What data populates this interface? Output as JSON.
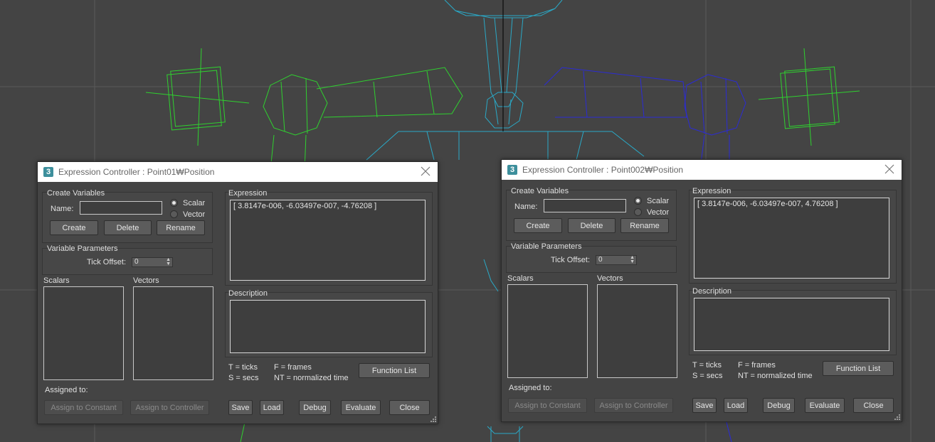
{
  "viewport": {
    "wire_colors": {
      "cyan": "#2aa9c7",
      "green": "#2fd12f",
      "blue": "#2b2bd6",
      "grid": "#5a5a5a"
    }
  },
  "dialogs": [
    {
      "title": "Expression Controller : Point01₩Position",
      "create_variables": "Create Variables",
      "name_label": "Name:",
      "name_value": "",
      "scalar_label": "Scalar",
      "vector_label": "Vector",
      "create": "Create",
      "delete": "Delete",
      "rename": "Rename",
      "variable_parameters": "Variable Parameters",
      "tick_offset_label": "Tick Offset:",
      "tick_offset_value": "0",
      "scalars": "Scalars",
      "vectors": "Vectors",
      "expression_label": "Expression",
      "expression_text": "[ 3.8147e-006, -6.03497e-007, -4.76208 ]",
      "description_label": "Description",
      "description_text": "",
      "legend_t": "T = ticks",
      "legend_s": "S = secs",
      "legend_f": "F = frames",
      "legend_nt": "NT = normalized time",
      "function_list": "Function List",
      "assigned_to": "Assigned to:",
      "assign_constant": "Assign to Constant",
      "assign_controller": "Assign to Controller",
      "save": "Save",
      "load": "Load",
      "debug": "Debug",
      "evaluate": "Evaluate",
      "close": "Close"
    },
    {
      "title": "Expression Controller : Point002₩Position",
      "create_variables": "Create Variables",
      "name_label": "Name:",
      "name_value": "",
      "scalar_label": "Scalar",
      "vector_label": "Vector",
      "create": "Create",
      "delete": "Delete",
      "rename": "Rename",
      "variable_parameters": "Variable Parameters",
      "tick_offset_label": "Tick Offset:",
      "tick_offset_value": "0",
      "scalars": "Scalars",
      "vectors": "Vectors",
      "expression_label": "Expression",
      "expression_text": "[ 3.8147e-006, -6.03497e-007, 4.76208 ]",
      "description_label": "Description",
      "description_text": "",
      "legend_t": "T = ticks",
      "legend_s": "S = secs",
      "legend_f": "F = frames",
      "legend_nt": "NT = normalized time",
      "function_list": "Function List",
      "assigned_to": "Assigned to:",
      "assign_constant": "Assign to Constant",
      "assign_controller": "Assign to Controller",
      "save": "Save",
      "load": "Load",
      "debug": "Debug",
      "evaluate": "Evaluate",
      "close": "Close"
    }
  ]
}
